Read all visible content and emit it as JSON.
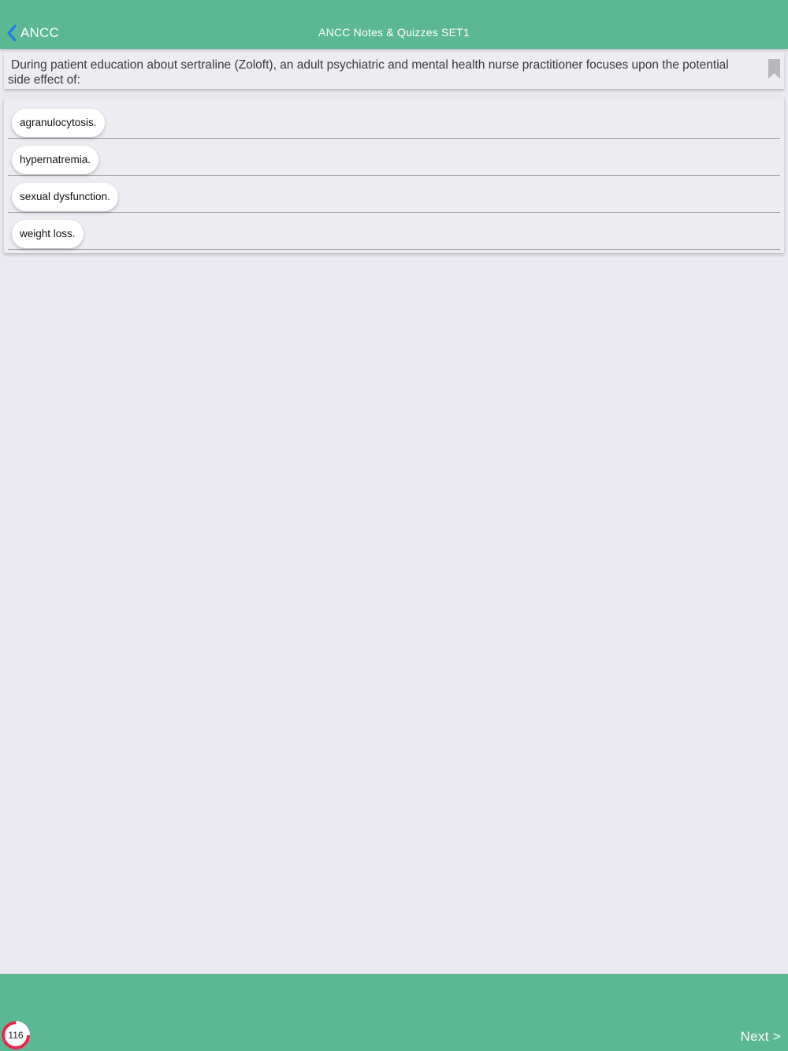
{
  "nav": {
    "back_label": "ANCC",
    "title": "ANCC Notes & Quizzes SET1"
  },
  "question": {
    "text": "During patient education about sertraline (Zoloft), an adult psychiatric and mental health nurse practitioner focuses upon the potential side effect of:"
  },
  "answers": [
    {
      "label": "agranulocytosis."
    },
    {
      "label": "hypernatremia."
    },
    {
      "label": "sexual dysfunction."
    },
    {
      "label": "weight loss."
    }
  ],
  "footer": {
    "question_number": "116",
    "next_label": "Next >"
  },
  "colors": {
    "header_green": "#5bb893",
    "back_chevron_blue": "#1e7bf0",
    "progress_red": "#e8254b",
    "background": "#e9e9ef"
  }
}
